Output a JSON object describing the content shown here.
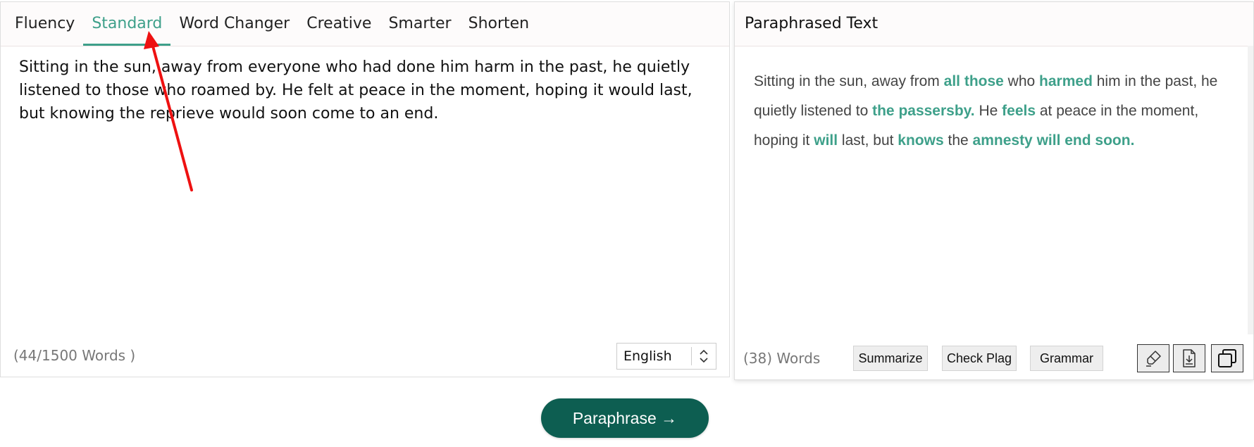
{
  "tabs": [
    {
      "label": "Fluency",
      "active": false
    },
    {
      "label": "Standard",
      "active": true
    },
    {
      "label": "Word Changer",
      "active": false
    },
    {
      "label": "Creative",
      "active": false
    },
    {
      "label": "Smarter",
      "active": false
    },
    {
      "label": "Shorten",
      "active": false
    }
  ],
  "input": {
    "text": "Sitting in the sun, away from everyone who had done him harm in the past, he quietly listened to those who roamed by. He felt at peace in the moment, hoping it would last, but knowing the reprieve would soon come to an end.",
    "word_count": "(44/1500 Words )",
    "language": "English"
  },
  "output": {
    "title": "Paraphrased Text",
    "segments": [
      {
        "text": "Sitting in the sun, away from ",
        "changed": false
      },
      {
        "text": "all those",
        "changed": true
      },
      {
        "text": " who ",
        "changed": false
      },
      {
        "text": "harmed",
        "changed": true
      },
      {
        "text": " him in the past, he quietly listened to ",
        "changed": false
      },
      {
        "text": "the passersby.",
        "changed": true
      },
      {
        "text": " He ",
        "changed": false
      },
      {
        "text": "feels",
        "changed": true
      },
      {
        "text": " at peace in the moment, hoping it ",
        "changed": false
      },
      {
        "text": "will",
        "changed": true
      },
      {
        "text": " last, but ",
        "changed": false
      },
      {
        "text": "knows",
        "changed": true
      },
      {
        "text": " the ",
        "changed": false
      },
      {
        "text": "amnesty will end soon.",
        "changed": true
      }
    ],
    "word_count_num": "(38)",
    "word_count_suffix": " Words",
    "buttons": {
      "summarize": "Summarize",
      "check_plag": "Check Plag",
      "grammar": "Grammar"
    },
    "icons": [
      "highlighter-icon",
      "download-icon",
      "copy-icon"
    ]
  },
  "paraphrase_button": "Paraphrase →",
  "colors": {
    "accent": "#3ea08a",
    "primary_button": "#0d5e51",
    "annotation_arrow": "#ee1111"
  }
}
